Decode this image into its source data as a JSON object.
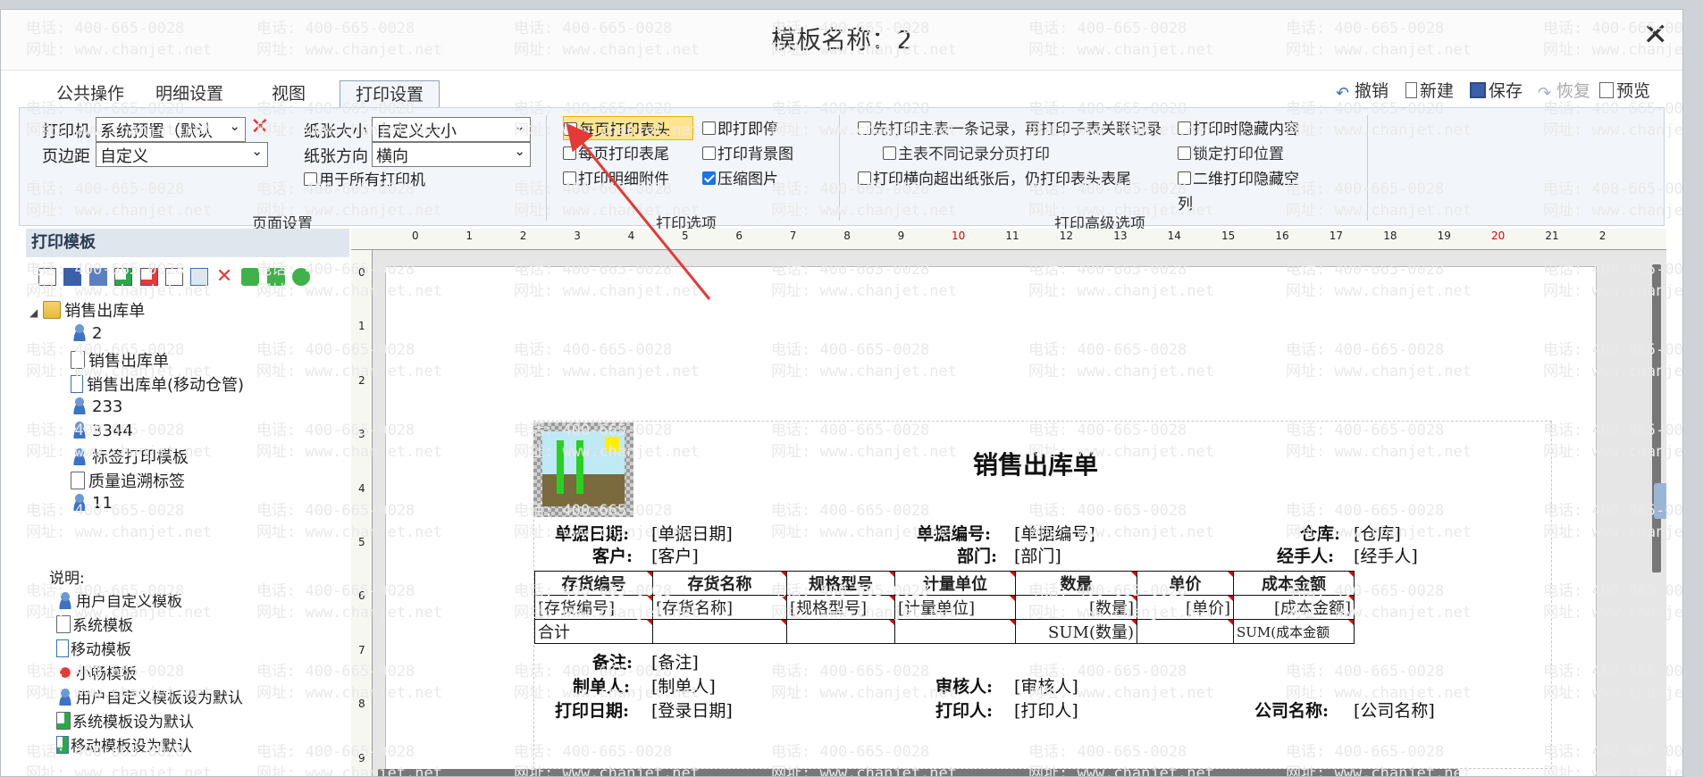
{
  "window": {
    "title": "模板名称：2",
    "close": "✕"
  },
  "tabs": [
    {
      "label": "公共操作",
      "active": false
    },
    {
      "label": "明细设置",
      "active": false
    },
    {
      "label": "视图",
      "active": false
    },
    {
      "label": "打印设置",
      "active": true
    }
  ],
  "toolbar": {
    "undo": "撤销",
    "new": "新建",
    "save": "保存",
    "restore": "恢复",
    "preview": "预览"
  },
  "page_setup": {
    "printer_label": "打印机",
    "printer_value": "系统预置（默认",
    "margin_label": "页边距",
    "margin_value": "自定义",
    "paper_size_label": "纸张大小",
    "paper_size_value": "自定义大小",
    "orientation_label": "纸张方向",
    "orientation_value": "横向",
    "all_printers": "用于所有打印机",
    "group": "页面设置"
  },
  "print_options": {
    "header_each_page": "每页打印表头",
    "footer_each_page": "每页打印表尾",
    "detail_attachment": "打印明细附件",
    "print_stop": "即打即停",
    "background": "打印背景图",
    "compress": "压缩图片",
    "group": "打印选项"
  },
  "advanced": {
    "master_first": "先打印主表一条记录，再打印子表关联记录",
    "page_per_record": "主表不同记录分页打印",
    "overflow_header": "打印横向超出纸张后，仍打印表头表尾",
    "hide_content": "打印时隐藏内容",
    "lock_position": "锁定打印位置",
    "qr_hide_empty": "二维打印隐藏空",
    "qr_hide_empty_2": "列",
    "group": "打印高级选项"
  },
  "left_panel": {
    "title": "打印模板",
    "root": "销售出库单",
    "items": [
      "2",
      "销售出库单",
      "销售出库单(移动仓管)",
      "233",
      "3344",
      "标签打印模板",
      "质量追溯标签",
      "11"
    ],
    "legend_title": "说明:",
    "legend": [
      "用户自定义模板",
      "系统模板",
      "移动模板",
      "小畅模板",
      "用户自定义模板设为默认",
      "系统模板设为默认",
      "移动模板设为默认"
    ]
  },
  "ruler": {
    "h": [
      "0",
      "1",
      "2",
      "3",
      "4",
      "5",
      "6",
      "7",
      "8",
      "9",
      "10",
      "11",
      "12",
      "13",
      "14",
      "15",
      "16",
      "17",
      "18",
      "19",
      "20",
      "21",
      "2"
    ],
    "v": [
      "0",
      "1",
      "2",
      "3",
      "4",
      "5",
      "6",
      "7",
      "8",
      "9"
    ]
  },
  "report": {
    "title": "销售出库单",
    "doc_date_label": "单据日期:",
    "doc_date": "[单据日期]",
    "doc_no_label": "单据编号:",
    "doc_no": "[单据编号]",
    "warehouse_label": "仓库:",
    "warehouse": "[仓库]",
    "customer_label": "客户:",
    "customer": "[客户]",
    "dept_label": "部门:",
    "dept": "[部门]",
    "handler_label": "经手人:",
    "handler": "[经手人]",
    "columns": [
      "存货编号",
      "存货名称",
      "规格型号",
      "计量单位",
      "数量",
      "单价",
      "成本金额"
    ],
    "row": [
      "[存货编号]",
      "[存货名称]",
      "[规格型号]",
      "[计量单位]",
      "[数量]",
      "[单价]",
      "[成本金额]"
    ],
    "total": [
      "合计",
      "",
      "",
      "",
      "SUM(数量)",
      "",
      "SUM(成本金额"
    ],
    "remark_label": "备注:",
    "remark": "[备注]",
    "maker_label": "制单人:",
    "maker": "[制单人]",
    "auditor_label": "审核人:",
    "auditor": "[审核人]",
    "print_date_label": "打印日期:",
    "print_date": "[登录日期]",
    "printer_label": "打印人:",
    "printer": "[打印人]",
    "company_label": "公司名称:",
    "company": "[公司名称]"
  },
  "watermark": {
    "phone": "电话: 400-665-0028",
    "site": "网址: www.chanjet.net"
  },
  "colors": {
    "accent": "#1a73e8",
    "delete": "#e53935",
    "arrow": "#e53935",
    "highlight": "#ffe591"
  }
}
